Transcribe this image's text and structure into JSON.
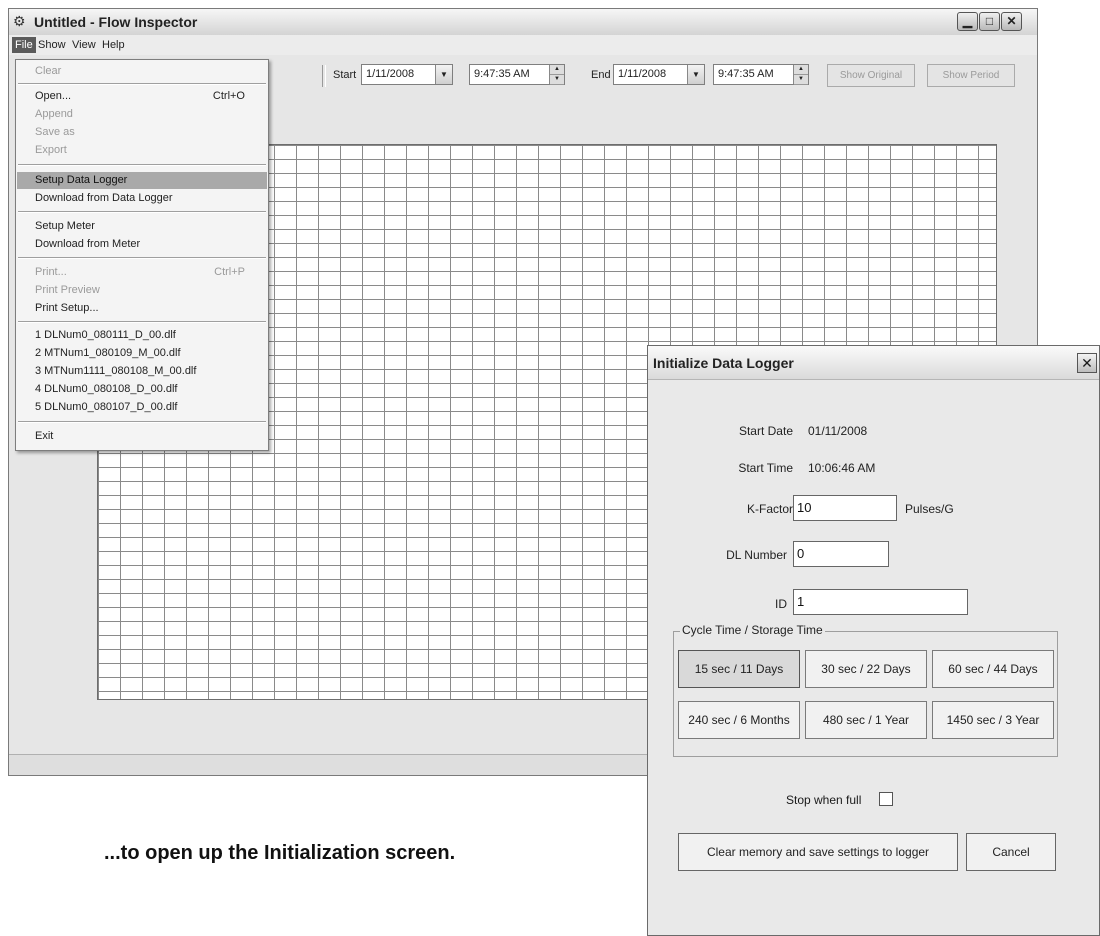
{
  "window": {
    "title": "Untitled - Flow Inspector",
    "icon": "flow-app-icon",
    "minimize_glyph": "▁",
    "maximize_glyph": "□",
    "close_glyph": "✕"
  },
  "menubar": {
    "items": [
      "File",
      "Show",
      "View",
      "Help"
    ],
    "active": "File"
  },
  "toolbar": {
    "start_label": "Start",
    "start_date": "1/11/2008",
    "start_time": "9:47:35 AM",
    "end_label": "End",
    "end_date": "1/11/2008",
    "end_time": "9:47:35 AM",
    "show_original": "Show Original",
    "show_period": "Show Period"
  },
  "file_menu": {
    "clear": "Clear",
    "open": "Open...",
    "open_shortcut": "Ctrl+O",
    "append": "Append",
    "save_as": "Save as",
    "export": "Export",
    "setup_data_logger": "Setup Data Logger",
    "download_data_logger": "Download from Data Logger",
    "setup_meter": "Setup Meter",
    "download_meter": "Download from Meter",
    "print": "Print...",
    "print_shortcut": "Ctrl+P",
    "print_preview": "Print Preview",
    "print_setup": "Print Setup...",
    "recent": [
      "1 DLNum0_080111_D_00.dlf",
      "2 MTNum1_080109_M_00.dlf",
      "3 MTNum1111_080108_M_00.dlf",
      "4 DLNum0_080108_D_00.dlf",
      "5 DLNum0_080107_D_00.dlf"
    ],
    "exit": "Exit"
  },
  "dialog": {
    "title": "Initialize Data Logger",
    "close_glyph": "✕",
    "start_date_label": "Start Date",
    "start_date": "01/11/2008",
    "start_time_label": "Start Time",
    "start_time": "10:06:46 AM",
    "kfactor_label": "K-Factor",
    "kfactor_value": "10",
    "kfactor_unit": "Pulses/G",
    "dl_number_label": "DL Number",
    "dl_number_value": "0",
    "id_label": "ID",
    "id_value": "1",
    "cycle_group_label": "Cycle Time / Storage Time",
    "cycle_options": [
      "15 sec / 11 Days",
      "30 sec / 22 Days",
      "60 sec / 44 Days",
      "240 sec / 6 Months",
      "480 sec / 1 Year",
      "1450 sec / 3 Year"
    ],
    "selected_cycle": "15 sec / 11 Days",
    "stop_when_full_label": "Stop when full",
    "stop_when_full_checked": false,
    "save_button": "Clear memory and save settings to logger",
    "cancel_button": "Cancel"
  },
  "caption": "...to open up the Initialization screen."
}
